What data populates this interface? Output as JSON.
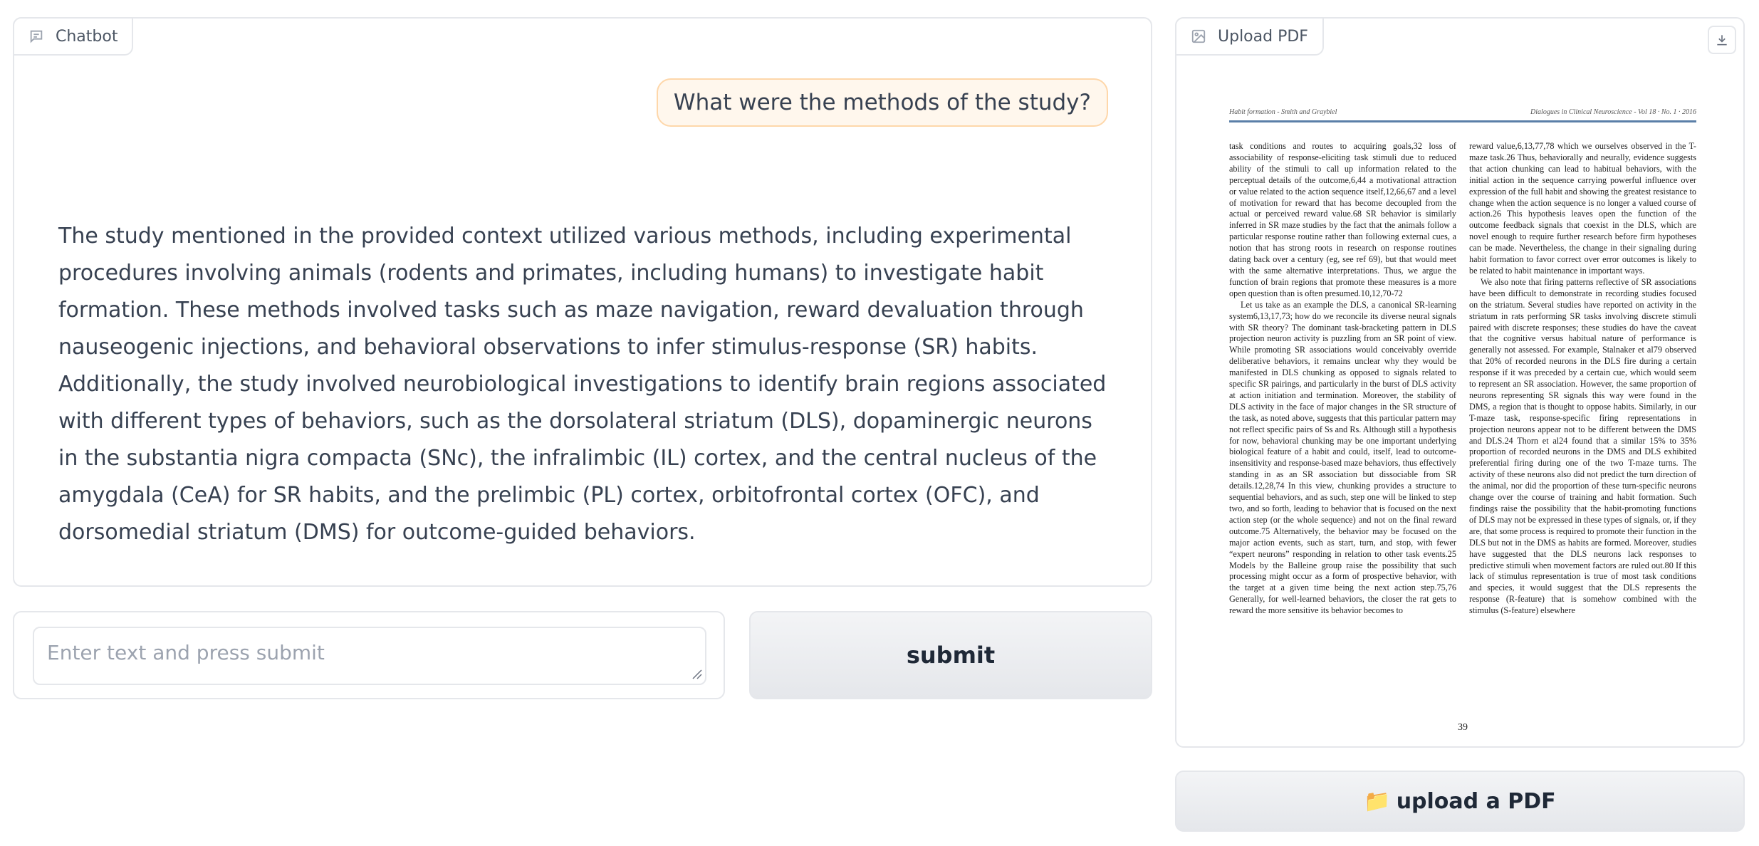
{
  "chatbot": {
    "label": "Chatbot",
    "messages": {
      "user": "What were the methods of the study?",
      "bot": "The study mentioned in the provided context utilized various methods, including experimental procedures involving animals (rodents and primates, including humans) to investigate habit formation. These methods involved tasks such as maze navigation, reward devaluation through nauseogenic injections, and behavioral observations to infer stimulus-response (SR) habits. Additionally, the study involved neurobiological investigations to identify brain regions associated with different types of behaviors, such as the dorsolateral striatum (DLS), dopaminergic neurons in the substantia nigra compacta (SNc), the infralimbic (IL) cortex, and the central nucleus of the amygdala (CeA) for SR habits, and the prelimbic (PL) cortex, orbitofrontal cortex (OFC), and dorsomedial striatum (DMS) for outcome-guided behaviors."
    }
  },
  "input": {
    "placeholder": "Enter text and press submit",
    "value": ""
  },
  "submit": {
    "label": "submit"
  },
  "pdf_panel": {
    "label": "Upload PDF",
    "page": {
      "header_left": "Habit formation - Smith and Graybiel",
      "header_right": "Dialogues in Clinical Neuroscience - Vol 18 · No. 1 · 2016",
      "col1": [
        "task conditions and routes to acquiring goals,32 loss of associability of response-eliciting task stimuli due to reduced ability of the stimuli to call up information related to the perceptual details of the outcome,6,44 a motivational attraction or value related to the action sequence itself,12,66,67 and a level of motivation for reward that has become decoupled from the actual or perceived reward value.68 SR behavior is similarly inferred in SR maze studies by the fact that the animals follow a particular response routine rather than following external cues, a notion that has strong roots in research on response routines dating back over a century (eg, see ref 69), but that would meet with the same alternative interpretations. Thus, we argue the function of brain regions that promote these measures is a more open question than is often presumed.10,12,70-72",
        "Let us take as an example the DLS, a canonical SR-learning system6,13,17,73; how do we reconcile its diverse neural signals with SR theory? The dominant task-bracketing pattern in DLS projection neuron activity is puzzling from an SR point of view. While promoting SR associations would conceivably override deliberative behaviors, it remains unclear why they would be manifested in DLS chunking as opposed to signals related to specific SR pairings, and particularly in the burst of DLS activity at action initiation and termination. Moreover, the stability of DLS activity in the face of major changes in the SR structure of the task, as noted above, suggests that this particular pattern may not reflect specific pairs of Ss and Rs. Although still a hypothesis for now, behavioral chunking may be one important underlying biological feature of a habit and could, itself, lead to outcome-insensitivity and response-based maze behaviors, thus effectively standing in as an SR association but dissociable from SR details.12,28,74 In this view, chunking provides a structure to sequential behaviors, and as such, step one will be linked to step two, and so forth, leading to behavior that is focused on the next action step (or the whole sequence) and not on the final reward outcome.75 Alternatively, the behavior may be focused on the major action events, such as start, turn, and stop, with fewer “expert neurons” responding in relation to other task events.25 Models by the Balleine group raise the possibility that such processing might occur as a form of prospective behavior, with the target at a given time being the next action step.75,76 Generally, for well-learned behaviors, the closer the rat gets to reward the more sensitive its behavior becomes to"
      ],
      "col2": [
        "reward value,6,13,77,78 which we ourselves observed in the T-maze task.26 Thus, behaviorally and neurally, evidence suggests that action chunking can lead to habitual behaviors, with the initial action in the sequence carrying powerful influence over expression of the full habit and showing the greatest resistance to change when the action sequence is no longer a valued course of action.26 This hypothesis leaves open the function of the outcome feedback signals that coexist in the DLS, which are novel enough to require further research before firm hypotheses can be made. Nevertheless, the change in their signaling during habit formation to favor correct over error outcomes is likely to be related to habit maintenance in important ways.",
        "We also note that firing patterns reflective of SR associations have been difficult to demonstrate in recording studies focused on the striatum. Several studies have reported on activity in the striatum in rats performing SR tasks involving discrete stimuli paired with discrete responses; these studies do have the caveat that the cognitive versus habitual nature of performance is generally not assessed. For example, Stalnaker et al79 observed that 20% of recorded neurons in the DLS fire during a certain response if it was preceded by a certain cue, which would seem to represent an SR association. However, the same proportion of neurons representing SR signals this way were found in the DMS, a region that is thought to oppose habits. Similarly, in our T-maze task, response-specific firing representations in projection neurons appear not to be different between the DMS and DLS.24 Thorn et al24 found that a similar 15% to 35% proportion of recorded neurons in the DMS and DLS exhibited preferential firing during one of the two T-maze turns. The activity of these neurons also did not predict the turn direction of the animal, nor did the proportion of these turn-specific neurons change over the course of training and habit formation. Such findings raise the possibility that the habit-promoting functions of DLS may not be expressed in these types of signals, or, if they are, that some process is required to promote their function in the DLS but not in the DMS as habits are formed. Moreover, studies have suggested that the DLS neurons lack responses to predictive stimuli when movement factors are ruled out.80 If this lack of stimulus representation is true of most task conditions and species, it would suggest that the DLS represents the response (R-feature) that is somehow combined with the stimulus (S-feature) elsewhere"
      ],
      "page_number": "39"
    }
  },
  "upload": {
    "label": "upload a PDF",
    "icon": "folder-icon"
  },
  "colors": {
    "user_bubble_bg": "#fff7ed",
    "user_bubble_border": "#fed7aa",
    "border": "#e5e7eb",
    "button_bg": "#e5e7eb"
  }
}
